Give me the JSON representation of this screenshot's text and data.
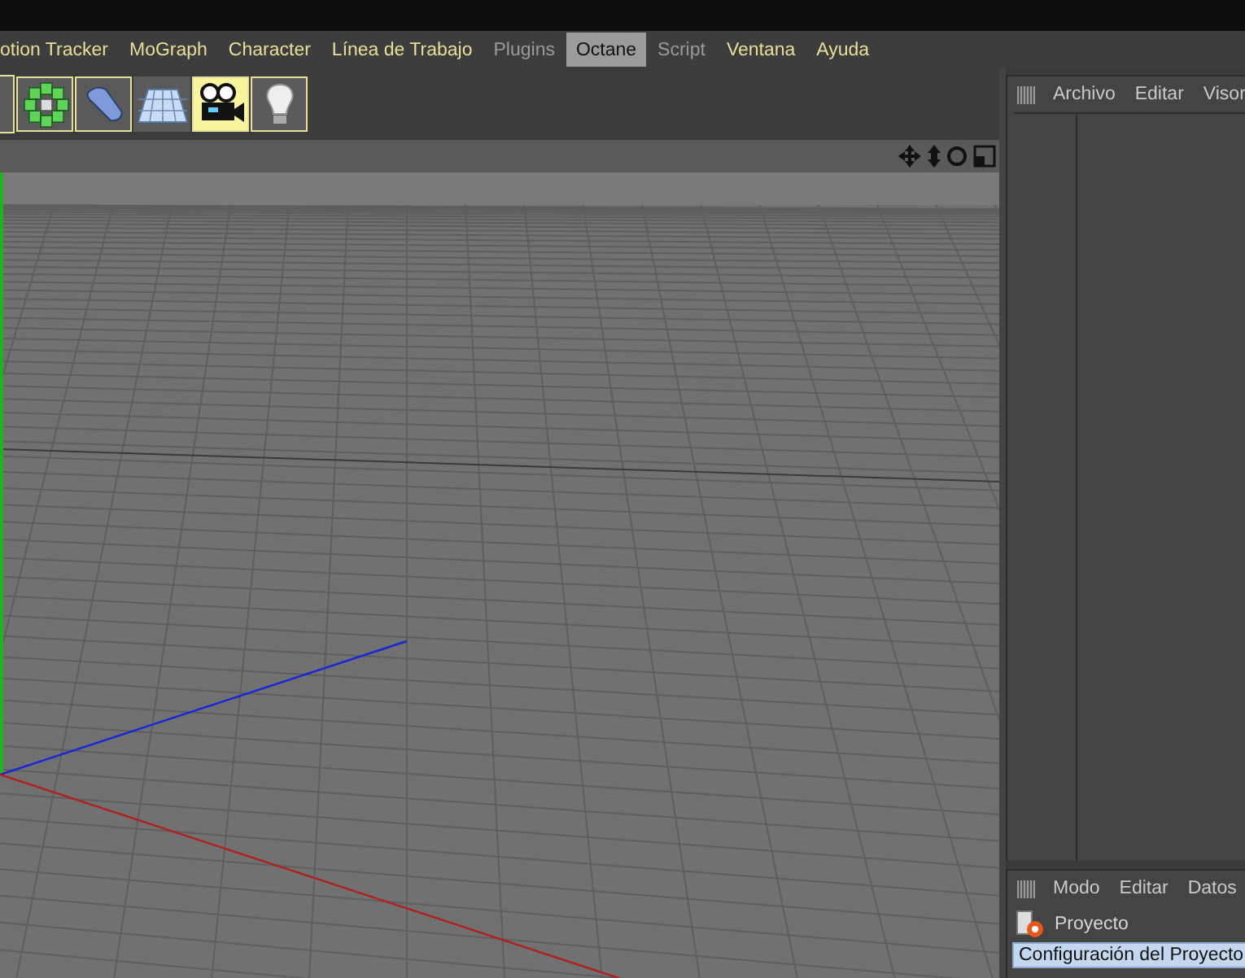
{
  "menu_bar": {
    "items": [
      {
        "label": "otion Tracker",
        "selected": false,
        "disabled": false
      },
      {
        "label": "MoGraph",
        "selected": false,
        "disabled": false
      },
      {
        "label": "Character",
        "selected": false,
        "disabled": false
      },
      {
        "label": "Línea de Trabajo",
        "selected": false,
        "disabled": false
      },
      {
        "label": "Plugins",
        "selected": false,
        "disabled": true
      },
      {
        "label": "Octane",
        "selected": true,
        "disabled": false
      },
      {
        "label": "Script",
        "selected": false,
        "disabled": true
      },
      {
        "label": "Ventana",
        "selected": false,
        "disabled": false
      },
      {
        "label": "Ayuda",
        "selected": false,
        "disabled": false
      }
    ]
  },
  "toolbar": {
    "tools": [
      {
        "kind": "cloner",
        "active": false
      },
      {
        "kind": "deformer",
        "active": false
      },
      {
        "kind": "floor",
        "active": false
      },
      {
        "kind": "camera",
        "active": true
      },
      {
        "kind": "light",
        "active": false
      }
    ]
  },
  "object_panel": {
    "menu": [
      "Archivo",
      "Editar",
      "Visor"
    ]
  },
  "attributes_panel": {
    "menu": [
      "Modo",
      "Editar",
      "Datos"
    ],
    "title": "Proyecto",
    "tabs": [
      {
        "label": "Configuración del Proyecto",
        "selected": true
      }
    ]
  }
}
